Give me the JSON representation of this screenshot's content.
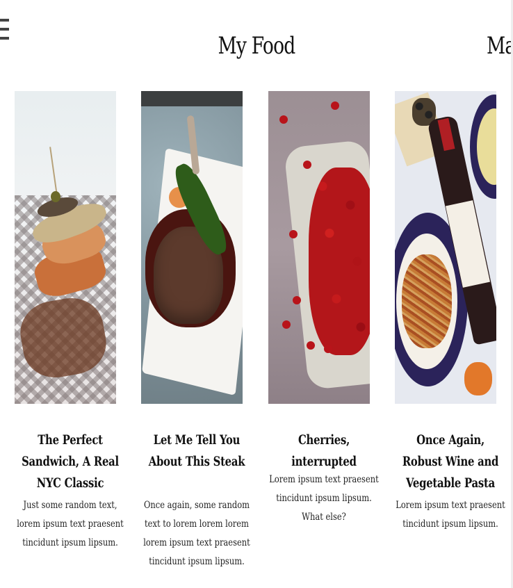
{
  "header": {
    "menu_icon": "hamburger-menu-icon",
    "title": "My Food",
    "nav_link": "Mail"
  },
  "cards": [
    {
      "title": "The Perfect Sandwich, A Real NYC Classic",
      "text": "Just some random text, lorem ipsum text praesent tincidunt ipsum lipsum.",
      "image": "sandwich photo"
    },
    {
      "title": "Let Me Tell You About This Steak",
      "text": "Once again, some random text to lorem lorem lorem lorem ipsum text praesent tincidunt ipsum lipsum.",
      "image": "steak photo"
    },
    {
      "title": "Cherries, interrupted",
      "text": "Lorem ipsum text praesent tincidunt ipsum lipsum. What else?",
      "image": "cherries photo"
    },
    {
      "title": "Once Again, Robust Wine and Vegetable Pasta",
      "text": "Lorem ipsum text praesent tincidunt ipsum lipsum.",
      "image": "wine and pasta photo"
    }
  ]
}
